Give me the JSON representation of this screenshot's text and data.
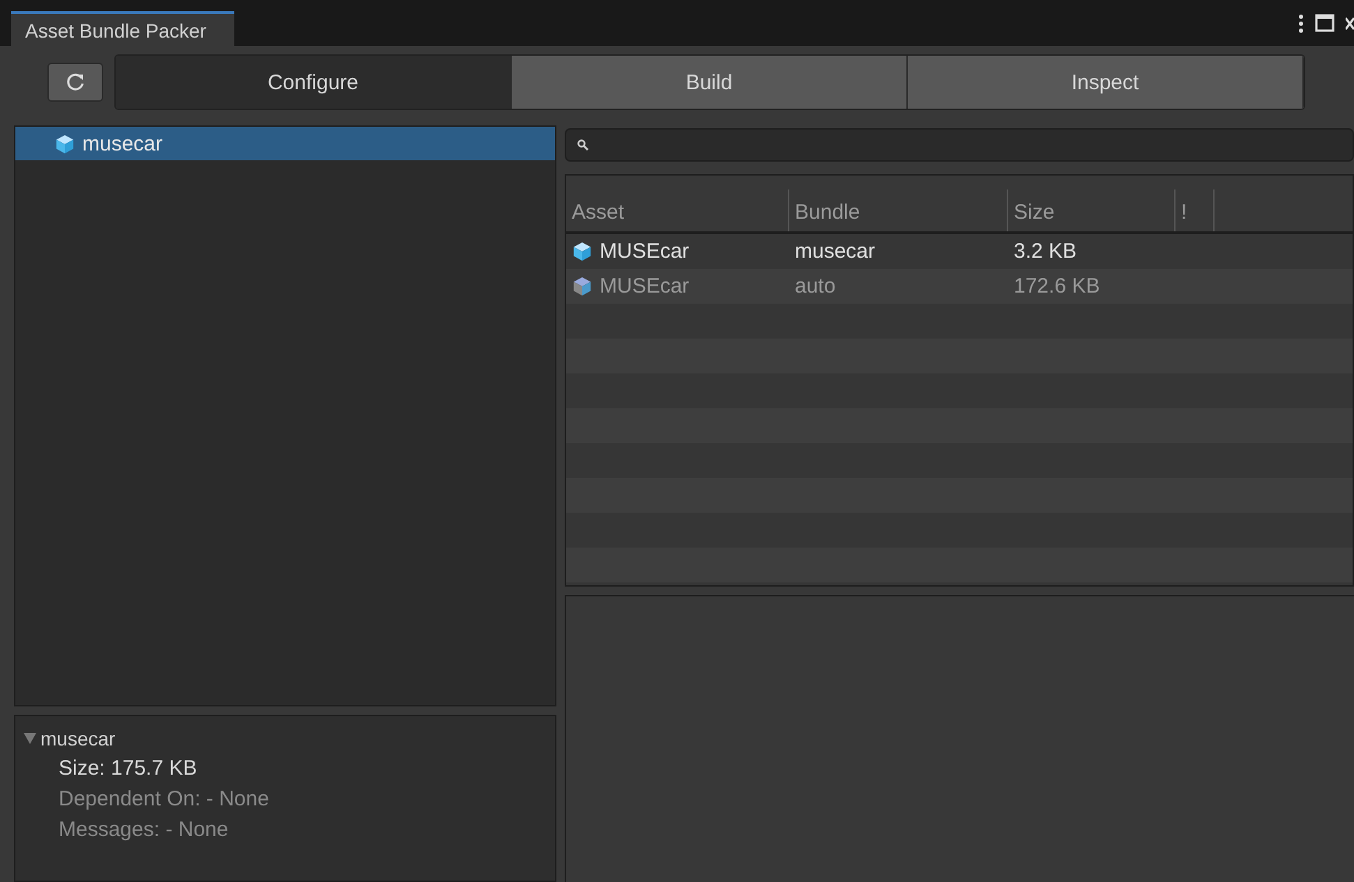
{
  "window": {
    "title": "Asset Bundle Packer"
  },
  "tabs": [
    {
      "label": "Configure",
      "selected": true
    },
    {
      "label": "Build",
      "selected": false
    },
    {
      "label": "Inspect",
      "selected": false
    }
  ],
  "tree": {
    "items": [
      {
        "label": "musecar",
        "selected": true
      }
    ]
  },
  "details": {
    "title": "musecar",
    "expanded": true,
    "lines": [
      {
        "text": "Size: 175.7 KB",
        "dimmed": false
      },
      {
        "text": "Dependent On: - None",
        "dimmed": true
      },
      {
        "text": "Messages: - None",
        "dimmed": true
      }
    ]
  },
  "table": {
    "columns": [
      "Asset",
      "Bundle",
      "Size",
      "!"
    ],
    "rows": [
      {
        "cells": [
          "MUSEcar",
          "musecar",
          "3.2 KB"
        ],
        "dimmed": false
      },
      {
        "cells": [
          "MUSEcar",
          "auto",
          "172.6 KB"
        ],
        "dimmed": true
      }
    ]
  }
}
